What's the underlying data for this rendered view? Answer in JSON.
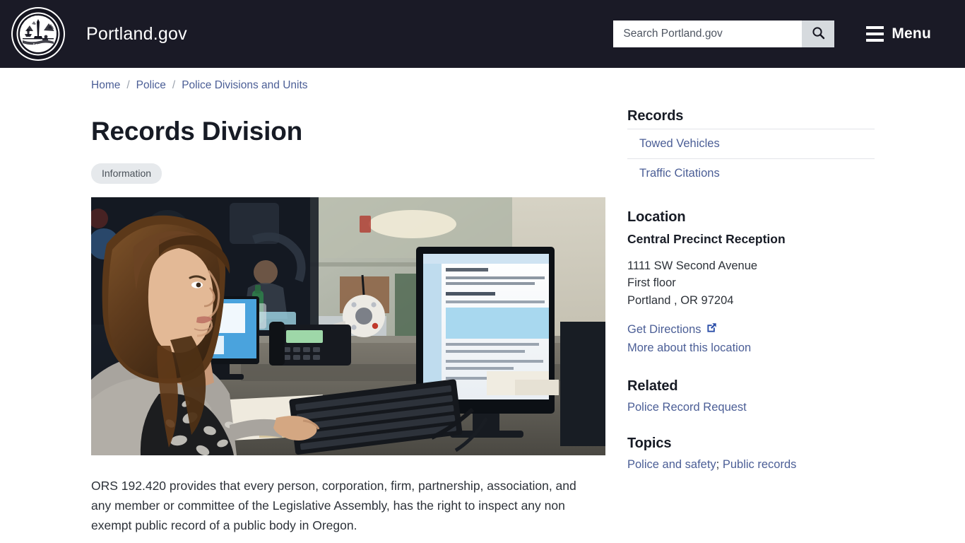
{
  "header": {
    "seal_alt": "City of Portland Oregon 1851 seal",
    "brand": "Portland.gov",
    "search": {
      "placeholder": "Search Portland.gov",
      "value": "",
      "button_icon": "search-icon"
    },
    "menu": {
      "label": "Menu",
      "icon": "hamburger-icon"
    },
    "background_color": "#1a1a26"
  },
  "breadcrumb": {
    "items": [
      {
        "label": "Home"
      },
      {
        "label": "Police"
      },
      {
        "label": "Police Divisions and Units"
      }
    ],
    "separator": "/"
  },
  "main": {
    "title": "Records Division",
    "tag": "Information",
    "image_caption": "Records staff member working at a desk with computer monitors, telephone and keyboard",
    "paragraph": "ORS 192.420 provides that every person, corporation, firm, partnership, association, and any member or committee of the Legislative Assembly, has the right to inspect any non exempt public record of a public body in Oregon."
  },
  "sidebar": {
    "records": {
      "heading": "Records",
      "links": [
        {
          "label": "Towed Vehicles"
        },
        {
          "label": "Traffic Citations"
        }
      ]
    },
    "location": {
      "heading": "Location",
      "name": "Central Precinct Reception",
      "address_line1": "1111 SW Second Avenue",
      "address_line2": "First floor",
      "address_line3": "Portland , OR 97204",
      "directions_label": "Get Directions",
      "directions_icon": "external-link-icon",
      "more_label": "More about this location"
    },
    "related": {
      "heading": "Related",
      "links": [
        {
          "label": "Police Record Request"
        }
      ]
    },
    "topics": {
      "heading": "Topics",
      "links": [
        {
          "label": "Police and safety"
        },
        {
          "label": "Public records"
        }
      ],
      "separator": "; "
    }
  },
  "colors": {
    "header_bg": "#1a1a26",
    "link": "#4b5e96",
    "text": "#2d3239",
    "heading": "#171b25",
    "tag_bg": "#e6e9ec",
    "search_btn_bg": "#d6dade"
  }
}
